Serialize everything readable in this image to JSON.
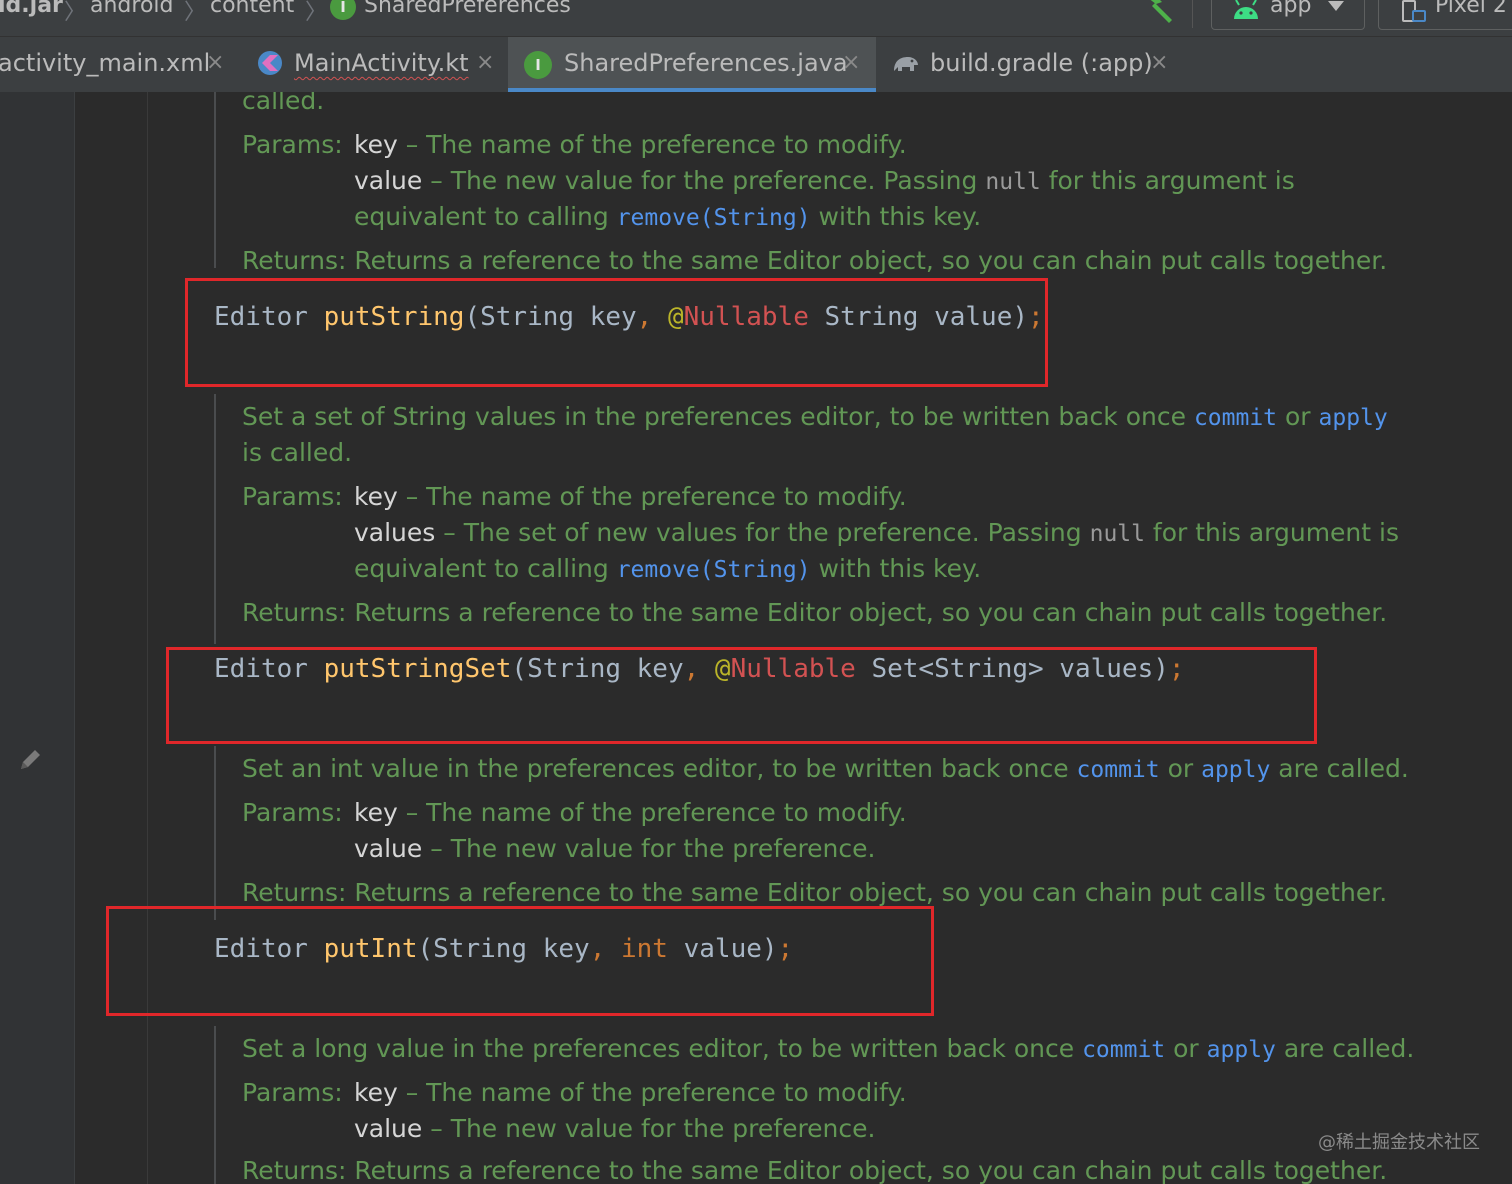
{
  "breadcrumb": {
    "items": [
      "id.jar",
      "android",
      "content",
      "SharedPreferences"
    ],
    "separator": "〉"
  },
  "toolbar": {
    "run_config": "app",
    "device": "Pixel 2"
  },
  "tabs": [
    {
      "label": "activity_main.xml",
      "active": false
    },
    {
      "label": "MainActivity.kt",
      "active": false
    },
    {
      "label": "SharedPreferences.java",
      "active": true
    },
    {
      "label": "build.gradle (:app)",
      "active": false
    }
  ],
  "tab_close": "×",
  "icon_letter": "I",
  "editor": {
    "doc1": {
      "l1": "called.",
      "params_label": "Params:",
      "p1_name": "key",
      "p1_desc": " – The name of the preference to modify.",
      "p2_name": "value",
      "p2_desc": " – The new value for the preference. Passing ",
      "null": "null",
      "p2_tail": " for this argument is",
      "l_equiv": "equivalent to calling ",
      "remove_link": "remove(String)",
      "l_equiv_tail": " with this key.",
      "returns_label": "Returns:",
      "returns_text": " Returns a reference to the same Editor object, so you can chain put calls together."
    },
    "code1": {
      "type": "Editor ",
      "fn": "putString",
      "args1": "(String key",
      "comma": ", ",
      "at": "@",
      "ann": "Nullable",
      "args2": " String value)",
      "semi": ";"
    },
    "doc2": {
      "l1a": "Set a set of String values in the preferences editor, to be written back once ",
      "commit": "commit",
      "or": " or ",
      "apply": "apply",
      "l2": "is called.",
      "params_label": "Params:",
      "p1_name": "key",
      "p1_desc": " – The name of the preference to modify.",
      "p2_name": "values",
      "p2_desc": " – The set of new values for the preference. Passing ",
      "null": "null",
      "p2_tail": " for this argument is",
      "l_equiv": "equivalent to calling ",
      "remove_link": "remove(String)",
      "l_equiv_tail": " with this key.",
      "returns_label": "Returns:",
      "returns_text": " Returns a reference to the same Editor object, so you can chain put calls together."
    },
    "code2": {
      "type": "Editor ",
      "fn": "putStringSet",
      "args1": "(String key",
      "comma": ", ",
      "at": "@",
      "ann": "Nullable",
      "args2": " Set<String> values)",
      "semi": ";"
    },
    "doc3": {
      "l1a": "Set an int value in the preferences editor, to be written back once ",
      "commit": "commit",
      "or": " or ",
      "apply": "apply",
      "l1b": " are called.",
      "params_label": "Params:",
      "p1_name": "key",
      "p1_desc": " – The name of the preference to modify.",
      "p2_name": "value",
      "p2_desc": " – The new value for the preference.",
      "returns_label": "Returns:",
      "returns_text": " Returns a reference to the same Editor object, so you can chain put calls together."
    },
    "code3": {
      "type": "Editor ",
      "fn": "putInt",
      "args1": "(String key",
      "comma": ", ",
      "kw": "int",
      "args2": " value)",
      "semi": ";"
    },
    "doc4": {
      "l1a": "Set a long value in the preferences editor, to be written back once ",
      "commit": "commit",
      "or": " or ",
      "apply": "apply",
      "l1b": " are called.",
      "params_label": "Params:",
      "p1_name": "key",
      "p1_desc": " – The name of the preference to modify.",
      "p2_name": "value",
      "p2_desc": " – The new value for the preference.",
      "returns_label": "Returns:",
      "returns_text": " Returns a reference to the same Editor object, so you can chain put calls together."
    }
  },
  "watermark": "@稀土掘金技术社区",
  "colors": {
    "background": "#2b2b2b",
    "doc_text": "#629755",
    "link": "#5394ec",
    "function": "#ffc66d",
    "keyword": "#cc7832",
    "highlight_box": "#e0272a",
    "tab_underline": "#4a88c7"
  }
}
